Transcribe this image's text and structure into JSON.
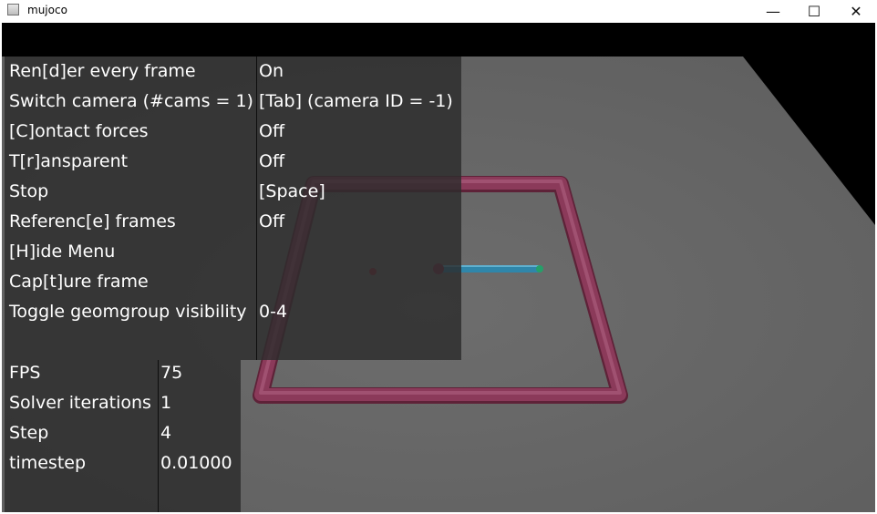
{
  "window": {
    "title": "mujoco",
    "controls": {
      "minimize_icon": "minimize-icon",
      "maximize_icon": "maximize-icon",
      "close_icon": "close-icon"
    }
  },
  "colors": {
    "floor": "#666666",
    "frame": "#8b3a5a",
    "rod": "#2f86aa",
    "tip": "#25a06a",
    "overlay": "#2c2c2c"
  },
  "menu": {
    "rows": [
      {
        "key": "Ren[d]er every frame",
        "value": "On"
      },
      {
        "key": "Switch camera (#cams = 1)",
        "value": "[Tab] (camera ID = -1)"
      },
      {
        "key": "[C]ontact forces",
        "value": "Off"
      },
      {
        "key": "T[r]ansparent",
        "value": "Off"
      },
      {
        "key": "Stop",
        "value": "[Space]"
      },
      {
        "key": "Referenc[e] frames",
        "value": "Off"
      },
      {
        "key": "[H]ide Menu",
        "value": ""
      },
      {
        "key": "Cap[t]ure frame",
        "value": ""
      },
      {
        "key": "Toggle geomgroup visibility",
        "value": "0-4"
      }
    ]
  },
  "info": {
    "rows": [
      {
        "key": "FPS",
        "value": "75"
      },
      {
        "key": "Solver iterations",
        "value": "1"
      },
      {
        "key": "Step",
        "value": "4"
      },
      {
        "key": "timestep",
        "value": "0.01000"
      }
    ]
  }
}
